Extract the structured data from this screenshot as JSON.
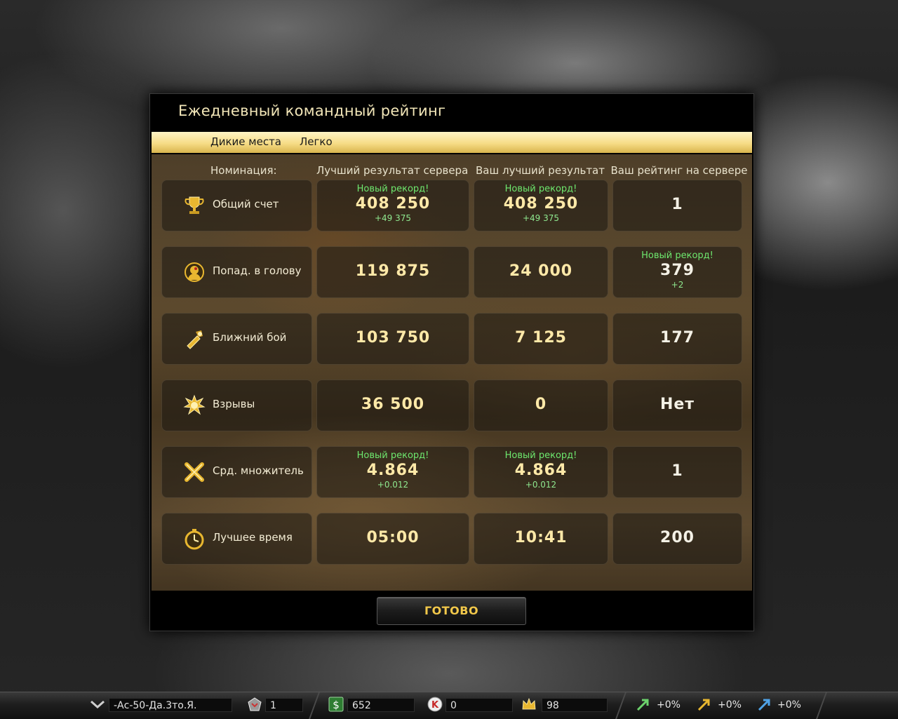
{
  "dialog": {
    "title": "Ежедневный командный рейтинг",
    "map": "Дикие места",
    "difficulty": "Легко",
    "ready_label": "ГОТОВО"
  },
  "columns": {
    "nomination": "Номинация:",
    "server_best": "Лучший результат сервера",
    "your_best": "Ваш лучший результат",
    "your_rank": "Ваш рейтинг на сервере"
  },
  "rows": [
    {
      "icon": "trophy-icon",
      "name": "Общий счет",
      "server": {
        "record": "Новый рекорд!",
        "value": "408 250",
        "delta": "+49 375"
      },
      "yours": {
        "record": "Новый рекорд!",
        "value": "408 250",
        "delta": "+49 375"
      },
      "rank": {
        "record": "",
        "value": "1",
        "delta": ""
      }
    },
    {
      "icon": "headshot-icon",
      "name": "Попад. в голову",
      "server": {
        "record": "",
        "value": "119 875",
        "delta": ""
      },
      "yours": {
        "record": "",
        "value": "24 000",
        "delta": ""
      },
      "rank": {
        "record": "Новый рекорд!",
        "value": "379",
        "delta": "+2"
      }
    },
    {
      "icon": "melee-icon",
      "name": "Ближний бой",
      "server": {
        "record": "",
        "value": "103 750",
        "delta": ""
      },
      "yours": {
        "record": "",
        "value": "7 125",
        "delta": ""
      },
      "rank": {
        "record": "",
        "value": "177",
        "delta": ""
      }
    },
    {
      "icon": "explosion-icon",
      "name": "Взрывы",
      "server": {
        "record": "",
        "value": "36 500",
        "delta": ""
      },
      "yours": {
        "record": "",
        "value": "0",
        "delta": ""
      },
      "rank": {
        "record": "",
        "value": "Нет",
        "delta": ""
      }
    },
    {
      "icon": "multiplier-icon",
      "name": "Срд. множитель",
      "server": {
        "record": "Новый рекорд!",
        "value": "4.864",
        "delta": "+0.012"
      },
      "yours": {
        "record": "Новый рекорд!",
        "value": "4.864",
        "delta": "+0.012"
      },
      "rank": {
        "record": "",
        "value": "1",
        "delta": ""
      }
    },
    {
      "icon": "stopwatch-icon",
      "name": "Лучшее время",
      "server": {
        "record": "",
        "value": "05:00",
        "delta": ""
      },
      "yours": {
        "record": "",
        "value": "10:41",
        "delta": ""
      },
      "rank": {
        "record": "",
        "value": "200",
        "delta": ""
      }
    }
  ],
  "bottombar": {
    "player_name": "-Ас-50-Да.3то.Я.",
    "rank_level": "1",
    "money": "652",
    "kredits": "0",
    "crowns": "98",
    "boost_xp": "+0%",
    "boost_money": "+0%",
    "boost_skill": "+0%"
  }
}
